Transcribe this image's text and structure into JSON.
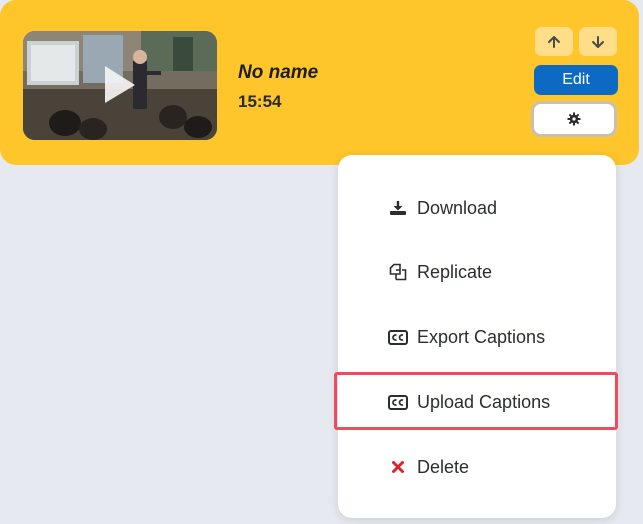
{
  "video": {
    "title": "No name",
    "duration": "15:54"
  },
  "controls": {
    "move_up_icon": "arrow-up-icon",
    "move_down_icon": "arrow-down-icon",
    "edit_label": "Edit",
    "settings_icon": "gear-icon"
  },
  "menu": {
    "items": [
      {
        "label": "Download",
        "icon": "download-icon"
      },
      {
        "label": "Replicate",
        "icon": "copy-icon"
      },
      {
        "label": "Export Captions",
        "icon": "closed-captions-icon"
      },
      {
        "label": "Upload Captions",
        "icon": "closed-captions-icon",
        "highlighted": true
      },
      {
        "label": "Delete",
        "icon": "close-x-icon",
        "icon_color": "#d9232e"
      }
    ]
  },
  "colors": {
    "card": "#ffc62b",
    "edit_button": "#0d6ac2",
    "highlight": "#ed4c5f"
  }
}
